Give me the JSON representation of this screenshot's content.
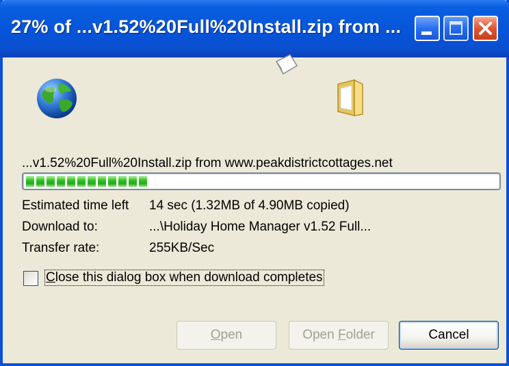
{
  "window": {
    "title": "27% of ...v1.52%20Full%20Install.zip from ..."
  },
  "download": {
    "source_line": "...v1.52%20Full%20Install.zip from www.peakdistrictcottages.net",
    "progress_percent": 27,
    "info": [
      {
        "label": "Estimated time left",
        "value": "14 sec (1.32MB of 4.90MB copied)"
      },
      {
        "label": "Download to:",
        "value": "...\\Holiday Home Manager v1.52 Full..."
      },
      {
        "label": "Transfer rate:",
        "value": "255KB/Sec"
      }
    ]
  },
  "options": {
    "close_when_done_label_first": "C",
    "close_when_done_label_rest": "lose this dialog box when download completes",
    "close_when_done_checked": false
  },
  "buttons": {
    "open_first": "O",
    "open_rest": "pen",
    "open_folder_first": "Open ",
    "open_folder_underline": "F",
    "open_folder_rest": "older",
    "cancel": "Cancel"
  },
  "icons": {
    "globe": "globe-icon",
    "paper": "flying-document-icon",
    "folder": "folder-icon",
    "minimize": "minimize-icon",
    "maximize": "maximize-icon",
    "close": "close-icon"
  },
  "colors": {
    "titlebar": "#0654d9",
    "progress_fill": "#37c32a",
    "window_bg": "#ece9d8",
    "close_button": "#e0542e"
  }
}
